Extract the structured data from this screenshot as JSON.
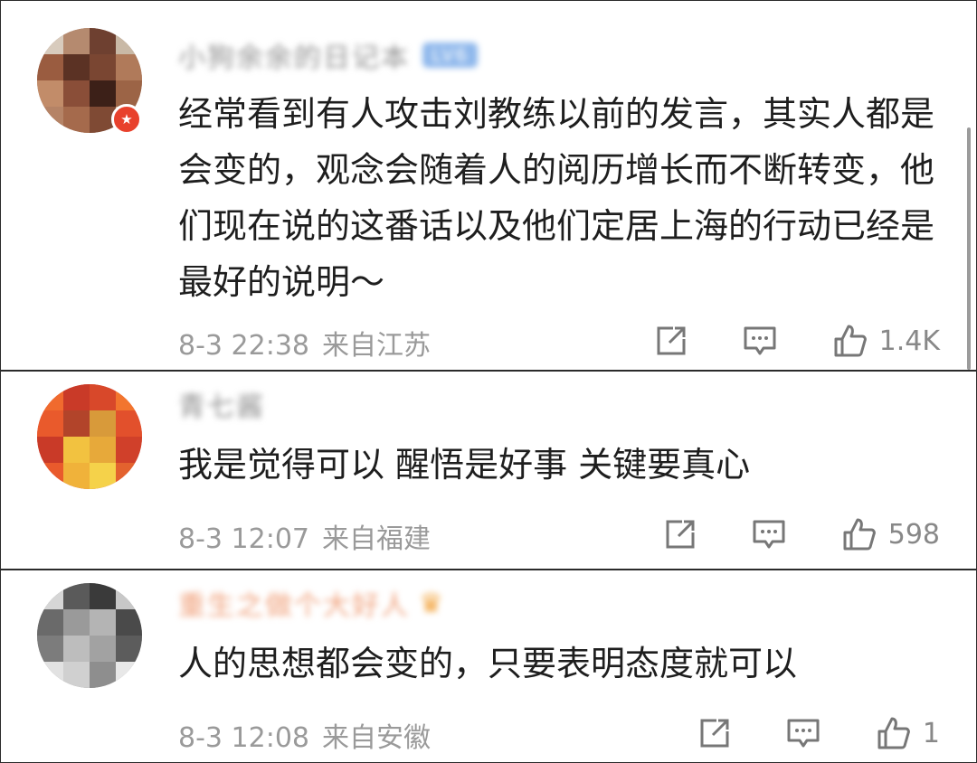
{
  "comments": [
    {
      "username": "小狗余余的日记本",
      "level_tag": "LV6",
      "text": "经常看到有人攻击刘教练以前的发言，其实人都是会变的，观念会随着人的阅历增长而不断转变，他们现在说的这番话以及他们定居上海的行动已经是最好的说明～",
      "time": "8-3 22:38",
      "location": "来自江苏",
      "likes": "1.4K"
    },
    {
      "username": "青七酱",
      "text": "我是觉得可以 醒悟是好事 关键要真心",
      "time": "8-3 12:07",
      "location": "来自福建",
      "likes": "598"
    },
    {
      "username": "重生之做个大好人",
      "text": "人的思想都会变的，只要表明态度就可以",
      "time": "8-3 12:08",
      "location": "来自安徽",
      "likes": "1"
    }
  ],
  "icons": {
    "share": "share-icon",
    "reply": "comment-icon",
    "like": "thumbs-up-icon",
    "badge": "star-badge-icon",
    "crown": "crown-icon"
  },
  "colors": {
    "text": "#1e1e1e",
    "meta": "#9a9a9a",
    "badge": "#e8412c",
    "vip_name": "#f0a07a"
  }
}
